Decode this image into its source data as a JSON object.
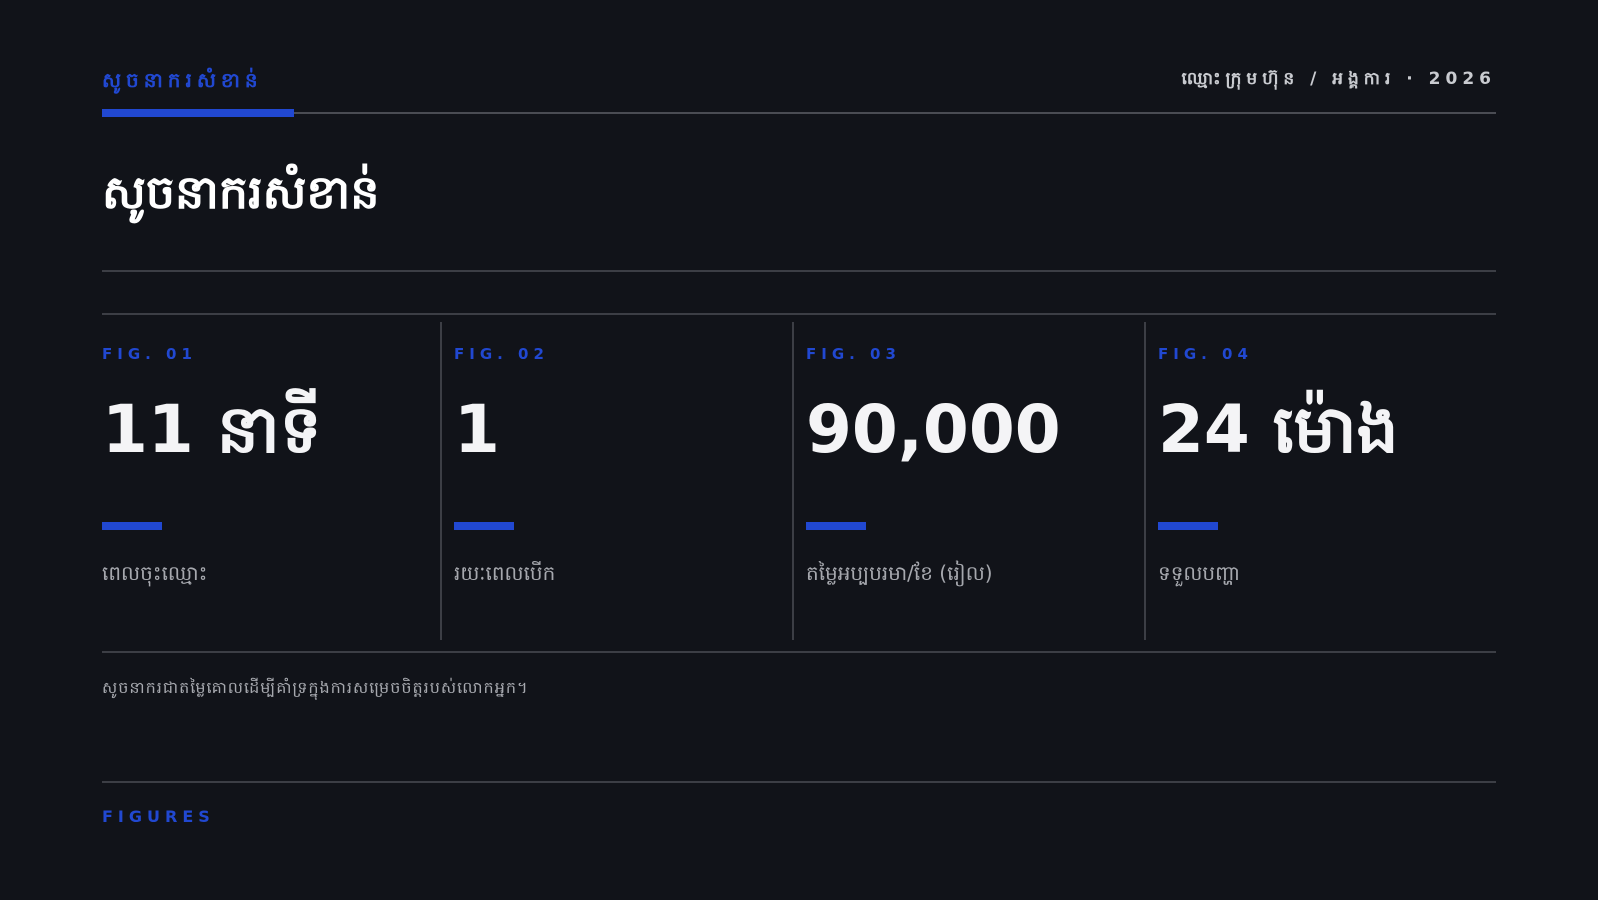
{
  "colors": {
    "accent": "#2148d1",
    "text_primary": "#f4f4f6",
    "text_muted": "#a6a8ae",
    "meta_text": "#c9cbd0",
    "background": "#111319"
  },
  "header": {
    "kicker": "សូចនាករសំខាន់",
    "meta": "ឈ្មោះក្រុមហ៊ុន / អង្គការ · 2026"
  },
  "page": {
    "title": "សូចនាករសំខាន់"
  },
  "stats": [
    {
      "fig": "FIG. 01",
      "value": "11 នាទី",
      "label": "ពេលចុះឈ្មោះ"
    },
    {
      "fig": "FIG. 02",
      "value": "1",
      "label": "រយៈពេលបើក"
    },
    {
      "fig": "FIG. 03",
      "value": "90,000",
      "label": "តម្លៃអប្បបរមា/ខែ (រៀល)"
    },
    {
      "fig": "FIG. 04",
      "value": "24 ម៉ោង",
      "label": "ទទួលបញ្ហា"
    }
  ],
  "footnote": "សូចនាករជាតម្លៃគោលដើម្បីគាំទ្រក្នុងការសម្រេចចិត្តរបស់លោកអ្នក។",
  "section_label": "FIGURES"
}
